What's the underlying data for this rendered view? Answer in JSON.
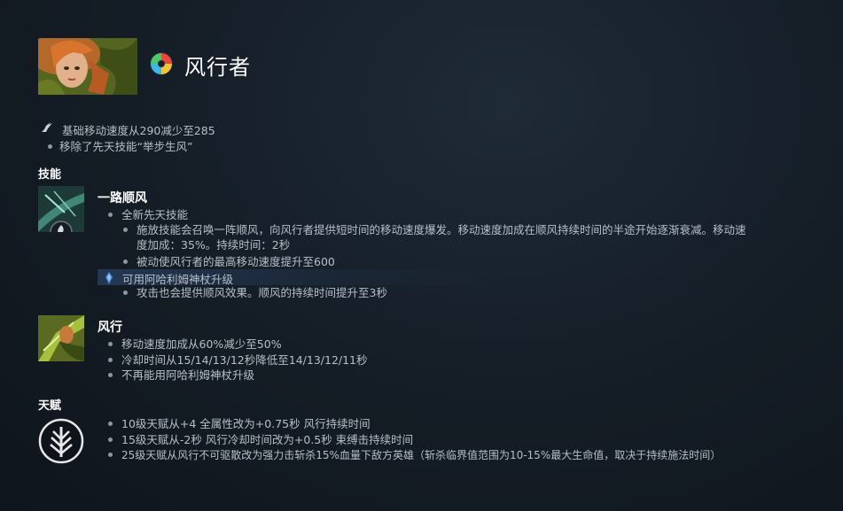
{
  "hero": {
    "name": "风行者",
    "accent": "#e0a040"
  },
  "general": [
    "基础移动速度从290减少至285",
    "移除了先天技能“举步生风”"
  ],
  "sections": {
    "abilities": "技能",
    "talents": "天赋"
  },
  "ability1": {
    "name": "一路顺风",
    "b1": "全新先天技能",
    "b2a": "施放技能会召唤一阵顺风，向风行者提供短时间的移动速度爆发。移动速度加成在顺风持续时间的半途开始逐渐衰减。移动速",
    "b2b": "度加成：35%。持续时间：2秒",
    "b3": "被动使风行者的最高移动速度提升至600",
    "aghs_label": "可用阿哈利姆神杖升级",
    "aghs_b1": "攻击也会提供顺风效果。顺风的持续时间提升至3秒"
  },
  "ability2": {
    "name": "风行",
    "b1": "移动速度加成从60%减少至50%",
    "b2": "冷却时间从15/14/13/12秒降低至14/13/12/11秒",
    "b3": "不再能用阿哈利姆神杖升级"
  },
  "talents": [
    "10级天赋从+4 全属性改为+0.75秒 风行持续时间",
    "15级天赋从-2秒 风行冷却时间改为+0.5秒 束缚击持续时间",
    "25级天赋从风行不可驱散改为强力击斩杀15%血量下敌方英雄（斩杀临界值范围为10-15%最大生命值，取决于持续施法时间）"
  ],
  "icons": {
    "hero": "windranger-attribute-icon",
    "movement": "winged-boot-icon",
    "aghs": "aghanims-scepter-icon",
    "talent": "talent-tree-icon"
  }
}
